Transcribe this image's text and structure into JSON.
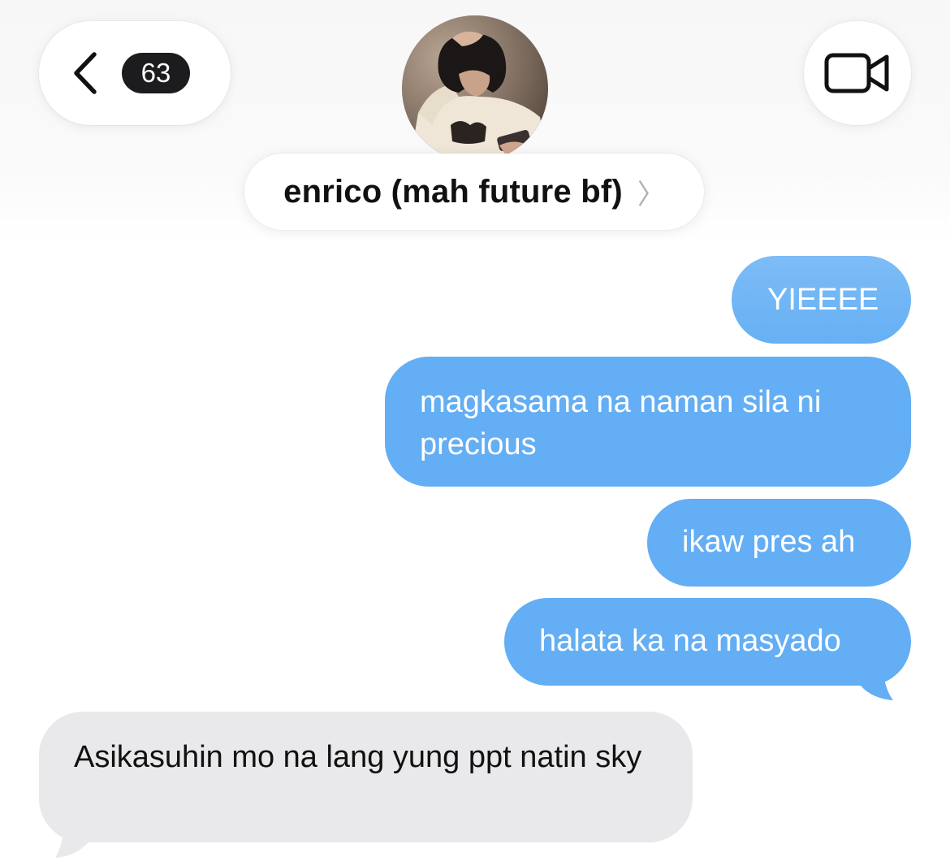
{
  "header": {
    "unread_count": "63",
    "contact_name": "enrico (mah future bf)",
    "name_chevron": "〉"
  },
  "messages": [
    {
      "direction": "sent",
      "text": "YIEEEE"
    },
    {
      "direction": "sent",
      "text": "magkasama na naman sila ni precious"
    },
    {
      "direction": "sent",
      "text": "ikaw pres ah"
    },
    {
      "direction": "sent",
      "text": "halata ka na masyado"
    },
    {
      "direction": "received",
      "text": "Asikasuhin mo na lang yung ppt natin sky"
    }
  ],
  "colors": {
    "sent_bubble": "#63aef4",
    "received_bubble": "#e9e9eb",
    "badge": "#1c1c1e"
  },
  "icons": {
    "back": "chevron-left-icon",
    "video": "video-camera-icon"
  }
}
